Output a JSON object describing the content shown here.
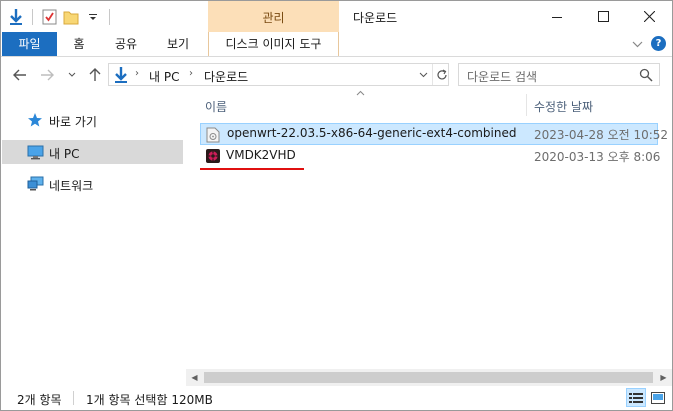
{
  "window": {
    "title": "다운로드",
    "context_group_label": "관리"
  },
  "ribbon": {
    "tabs": [
      {
        "label": "파일"
      },
      {
        "label": "홈"
      },
      {
        "label": "공유"
      },
      {
        "label": "보기"
      },
      {
        "label": "디스크 이미지 도구"
      }
    ]
  },
  "address": {
    "crumbs": [
      "내 PC",
      "다운로드"
    ],
    "search_placeholder": "다운로드 검색"
  },
  "navpane": {
    "items": [
      {
        "label": "바로 가기",
        "icon": "star-icon"
      },
      {
        "label": "내 PC",
        "icon": "computer-icon",
        "selected": true
      },
      {
        "label": "네트워크",
        "icon": "network-icon"
      }
    ]
  },
  "content": {
    "columns": {
      "name": "이름",
      "date": "수정한 날짜"
    },
    "files": [
      {
        "name": "openwrt-22.03.5-x86-64-generic-ext4-combined",
        "date": "2023-04-28 오전 10:52",
        "icon": "disk-image-icon",
        "selected": true
      },
      {
        "name": "VMDK2VHD",
        "date": "2020-03-13 오후 8:06",
        "icon": "app-icon",
        "selected": false
      }
    ]
  },
  "status": {
    "item_count": "2개 항목",
    "selection": "1개 항목 선택함 120MB"
  },
  "colors": {
    "accent": "#1c6ec0",
    "context": "#fcdfb8",
    "selection": "#cce8ff",
    "annotation": "#e01010"
  }
}
